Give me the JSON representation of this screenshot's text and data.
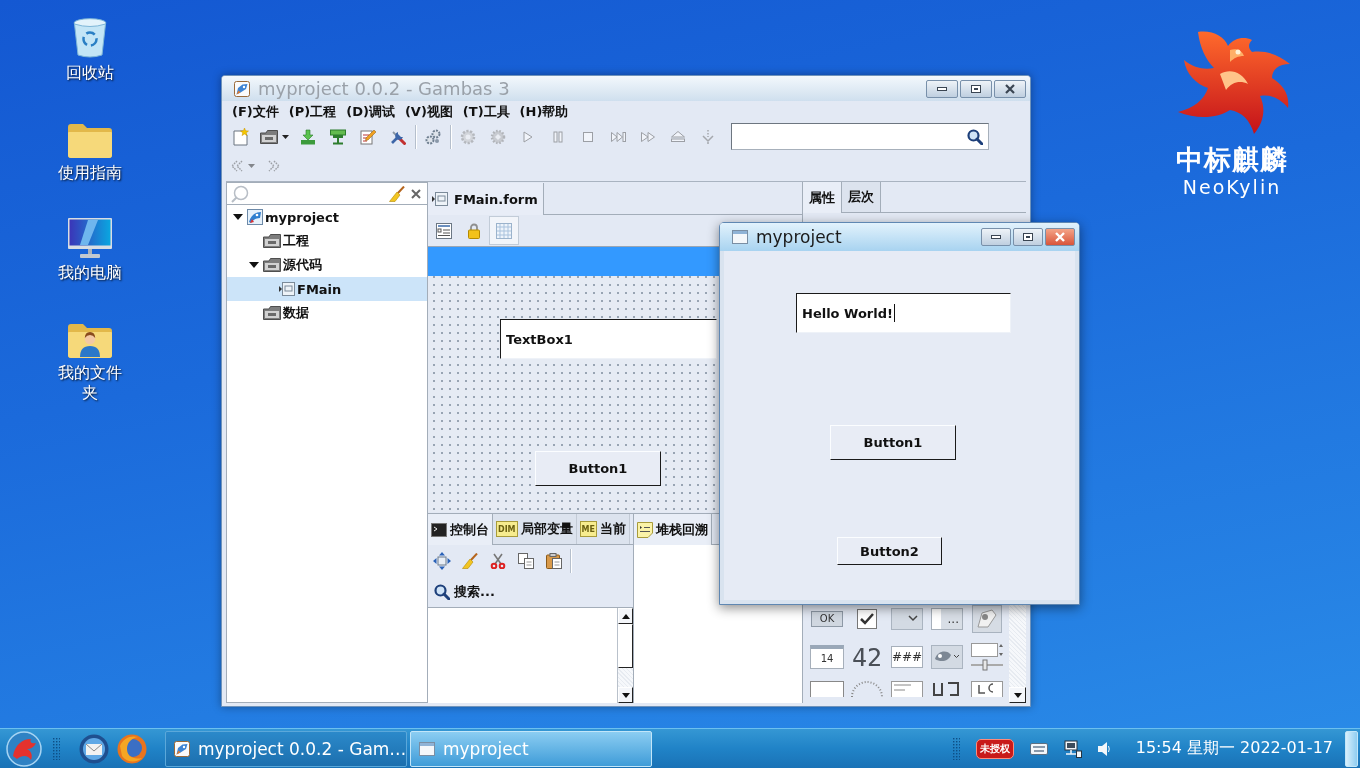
{
  "desktop_icons": [
    {
      "kind": "trash",
      "label": "回收站"
    },
    {
      "kind": "folder",
      "label": "使用指南"
    },
    {
      "kind": "computer",
      "label": "我的电脑"
    },
    {
      "kind": "user-folder",
      "label": "我的文件夹"
    }
  ],
  "logo": {
    "name": "中标麒麟",
    "latin": "NeoKylin"
  },
  "ide_window": {
    "title": "myproject 0.0.2 - Gambas 3",
    "active": false,
    "menu": [
      "(F)文件",
      "(P)工程",
      "(D)调试",
      "(V)视图",
      "(T)工具",
      "(H)帮助"
    ],
    "toolbar": [
      [
        {
          "kind": "new-file",
          "disabled": false
        },
        {
          "kind": "open",
          "disabled": false
        },
        {
          "kind": "install",
          "disabled": false
        },
        {
          "kind": "make",
          "disabled": false
        },
        {
          "kind": "edit",
          "disabled": false
        },
        {
          "kind": "tools",
          "disabled": false
        }
      ],
      [
        {
          "kind": "compile",
          "disabled": false
        }
      ],
      [
        {
          "kind": "gear",
          "disabled": true
        },
        {
          "kind": "gear-alt",
          "disabled": true
        },
        {
          "kind": "play",
          "disabled": true
        },
        {
          "kind": "pause",
          "disabled": true
        },
        {
          "kind": "stop",
          "disabled": true
        },
        {
          "kind": "skip",
          "disabled": true
        },
        {
          "kind": "ffwd",
          "disabled": true
        },
        {
          "kind": "eject",
          "disabled": true
        },
        {
          "kind": "step",
          "disabled": true
        }
      ]
    ],
    "nav_toolbar": [
      {
        "kind": "back",
        "disabled": true
      },
      {
        "kind": "forward",
        "disabled": true
      }
    ],
    "project_tree": [
      {
        "kind": "project",
        "label": "myproject",
        "selected": false,
        "expanded": true,
        "children": [
          {
            "kind": "folder",
            "label": "工程",
            "selected": false
          },
          {
            "kind": "folder",
            "label": "源代码",
            "selected": false,
            "expanded": true,
            "children": [
              {
                "kind": "form",
                "label": "FMain",
                "selected": true
              }
            ]
          },
          {
            "kind": "folder",
            "label": "数据",
            "selected": false
          }
        ]
      }
    ],
    "editor_tabs": [
      {
        "label": "FMain.form",
        "selected": true
      }
    ],
    "form_tools": [
      {
        "kind": "properties",
        "on": false
      },
      {
        "kind": "lock",
        "on": false
      },
      {
        "kind": "grid",
        "on": true
      }
    ],
    "form_controls": [
      {
        "kind": "textbox",
        "text": "TextBox1"
      },
      {
        "kind": "button",
        "text": "Button1"
      }
    ],
    "bottom_tabs": [
      {
        "kind": "console",
        "label": "控制台",
        "selected": true
      },
      {
        "kind": "note",
        "badge": "DIM",
        "label": "局部变量",
        "selected": false
      },
      {
        "kind": "note",
        "badge": "ME",
        "label": "当前",
        "selected": false
      }
    ],
    "console_tools": [
      {
        "kind": "move"
      },
      {
        "kind": "broom"
      },
      {
        "kind": "cut"
      },
      {
        "kind": "copy"
      },
      {
        "kind": "paste"
      }
    ],
    "console_search": "搜索...",
    "stack_tabs": [
      {
        "label": "堆栈回溯",
        "selected": true
      }
    ],
    "property_tabs": [
      {
        "label": "属性",
        "selected": true
      },
      {
        "label": "层次",
        "selected": false
      }
    ],
    "toolbox": [
      {
        "kind": "button",
        "label": "OK"
      },
      {
        "kind": "checkbox"
      },
      {
        "kind": "combobox"
      },
      {
        "kind": "buttonbox",
        "label": "..."
      },
      {
        "kind": "gambas"
      },
      {
        "kind": "datebox",
        "label": "14"
      },
      {
        "kind": "lcd",
        "label": "42"
      },
      {
        "kind": "maskbox",
        "label": "###"
      },
      {
        "kind": "colorbutton"
      },
      {
        "kind": "spinslider"
      },
      {
        "kind": "valuebox"
      },
      {
        "kind": "dial"
      },
      {
        "kind": "texteditor"
      },
      {
        "kind": "lcd-small"
      },
      {
        "kind": "label"
      }
    ]
  },
  "run_window": {
    "title": "myproject",
    "active": true,
    "controls": [
      {
        "kind": "textbox",
        "text": "Hello World!",
        "focused": true
      },
      {
        "kind": "button",
        "text": "Button1"
      },
      {
        "kind": "button",
        "text": "Button2"
      }
    ]
  },
  "taskbar": {
    "tasks": [
      {
        "kind": "ide",
        "label": "myproject 0.0.2 - Gam…",
        "selected": false
      },
      {
        "kind": "window",
        "label": "myproject",
        "selected": true
      }
    ],
    "badge": "未授权",
    "clock": "15:54 星期一 2022-01-17"
  }
}
